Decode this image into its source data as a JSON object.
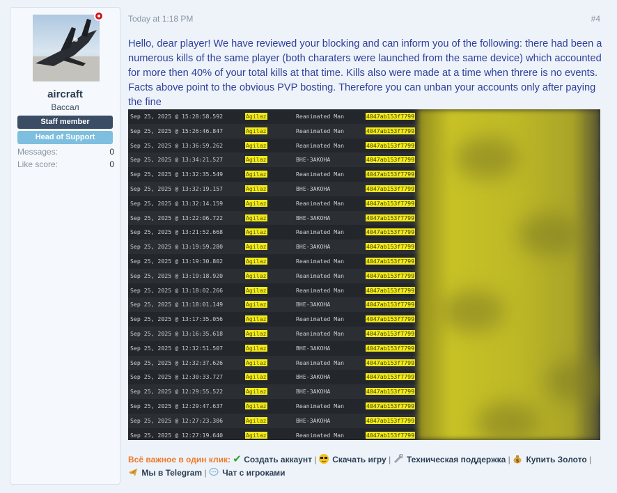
{
  "user": {
    "name": "aircraft",
    "title": "Вассал",
    "banners": [
      "Staff member",
      "Head of Support"
    ],
    "stats": [
      {
        "label": "Messages:",
        "value": "0"
      },
      {
        "label": "Like score:",
        "value": "0"
      }
    ]
  },
  "post": {
    "date": "Today at 1:18 PM",
    "number": "#4",
    "message": "Hello, dear player! We have reviewed your blocking and can inform you of the following: there had been a numerous kills of the same player (both charaters were launched from the same device) which accounted for more then 40% of your total kills at that time. Kills also were made at a time when threre is no events. Facts above point to the obvious PVP bosting. Therefore you can unban your accounts only after paying the fine"
  },
  "log": {
    "rows": [
      {
        "time": "Sep 25, 2025 @ 15:28:58.592",
        "name": "Agilaz",
        "char": "Reanimated Man",
        "id": "4047ab153f7799"
      },
      {
        "time": "Sep 25, 2025 @ 15:26:46.847",
        "name": "Agilaz",
        "char": "Reanimated Man",
        "id": "4047ab153f7799"
      },
      {
        "time": "Sep 25, 2025 @ 13:36:59.262",
        "name": "Agilaz",
        "char": "Reanimated Man",
        "id": "4047ab153f7799"
      },
      {
        "time": "Sep 25, 2025 @ 13:34:21.527",
        "name": "Agilaz",
        "char": "ВНЕ-ЗАКОНА",
        "id": "4047ab153f7799"
      },
      {
        "time": "Sep 25, 2025 @ 13:32:35.549",
        "name": "Agilaz",
        "char": "Reanimated Man",
        "id": "4047ab153f7799"
      },
      {
        "time": "Sep 25, 2025 @ 13:32:19.157",
        "name": "Agilaz",
        "char": "ВНЕ-ЗАКОНА",
        "id": "4047ab153f7799"
      },
      {
        "time": "Sep 25, 2025 @ 13:32:14.159",
        "name": "Agilaz",
        "char": "Reanimated Man",
        "id": "4047ab153f7799"
      },
      {
        "time": "Sep 25, 2025 @ 13:22:06.722",
        "name": "Agilaz",
        "char": "ВНЕ-ЗАКОНА",
        "id": "4047ab153f7799"
      },
      {
        "time": "Sep 25, 2025 @ 13:21:52.668",
        "name": "Agilaz",
        "char": "Reanimated Man",
        "id": "4047ab153f7799"
      },
      {
        "time": "Sep 25, 2025 @ 13:19:59.280",
        "name": "Agilaz",
        "char": "ВНЕ-ЗАКОНА",
        "id": "4047ab153f7799"
      },
      {
        "time": "Sep 25, 2025 @ 13:19:30.802",
        "name": "Agilaz",
        "char": "Reanimated Man",
        "id": "4047ab153f7799"
      },
      {
        "time": "Sep 25, 2025 @ 13:19:18.920",
        "name": "Agilaz",
        "char": "Reanimated Man",
        "id": "4047ab153f7799"
      },
      {
        "time": "Sep 25, 2025 @ 13:18:02.266",
        "name": "Agilaz",
        "char": "Reanimated Man",
        "id": "4047ab153f7799"
      },
      {
        "time": "Sep 25, 2025 @ 13:18:01.149",
        "name": "Agilaz",
        "char": "ВНЕ-ЗАКОНА",
        "id": "4047ab153f7799"
      },
      {
        "time": "Sep 25, 2025 @ 13:17:35.056",
        "name": "Agilaz",
        "char": "Reanimated Man",
        "id": "4047ab153f7799"
      },
      {
        "time": "Sep 25, 2025 @ 13:16:35.618",
        "name": "Agilaz",
        "char": "Reanimated Man",
        "id": "4047ab153f7799"
      },
      {
        "time": "Sep 25, 2025 @ 12:32:51.507",
        "name": "Agilaz",
        "char": "ВНЕ-ЗАКОНА",
        "id": "4047ab153f7799"
      },
      {
        "time": "Sep 25, 2025 @ 12:32:37.626",
        "name": "Agilaz",
        "char": "Reanimated Man",
        "id": "4047ab153f7799"
      },
      {
        "time": "Sep 25, 2025 @ 12:30:33.727",
        "name": "Agilaz",
        "char": "ВНЕ-ЗАКОНА",
        "id": "4047ab153f7799"
      },
      {
        "time": "Sep 25, 2025 @ 12:29:55.522",
        "name": "Agilaz",
        "char": "ВНЕ-ЗАКОНА",
        "id": "4047ab153f7799"
      },
      {
        "time": "Sep 25, 2025 @ 12:29:47.637",
        "name": "Agilaz",
        "char": "Reanimated Man",
        "id": "4047ab153f7799"
      },
      {
        "time": "Sep 25, 2025 @ 12:27:23.306",
        "name": "Agilaz",
        "char": "ВНЕ-ЗАКОНА",
        "id": "4047ab153f7799"
      },
      {
        "time": "Sep 25, 2025 @ 12:27:19.640",
        "name": "Agilaz",
        "char": "Reanimated Man",
        "id": "4047ab153f7799"
      }
    ]
  },
  "signature": {
    "lead": "Всё важное в один клик:",
    "links": [
      {
        "icon": "check-icon",
        "label": "Создать аккаунт"
      },
      {
        "icon": "sunglasses-icon",
        "label": "Скачать игру"
      },
      {
        "icon": "wrench-icon",
        "label": "Техническая поддержка"
      },
      {
        "icon": "money-bag-icon",
        "label": "Купить Золото"
      },
      {
        "icon": "telegram-plane-icon",
        "label": "Мы в Telegram"
      },
      {
        "icon": "chat-bubble-icon",
        "label": "Чат с игроками"
      }
    ],
    "separator": "|"
  }
}
